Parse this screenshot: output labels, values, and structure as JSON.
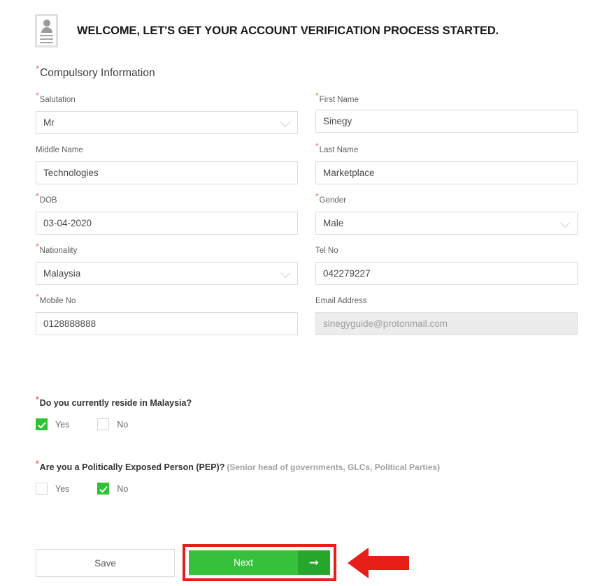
{
  "header": {
    "icon": "id-card-icon",
    "title": "WELCOME, LET'S GET YOUR ACCOUNT VERIFICATION PROCESS STARTED."
  },
  "section": {
    "required_marker": "*",
    "title": "Compulsory Information"
  },
  "colors": {
    "required_asterisk": "#f4665c",
    "accent_green": "#35c23a",
    "accent_green_dark": "#27a62c",
    "annotation_red": "#e81f19",
    "field_border": "#dcdcdc",
    "disabled_bg": "#ececec"
  },
  "fields": [
    {
      "name": "salutation",
      "label": "Salutation",
      "required": true,
      "type": "select",
      "value": "Mr",
      "disabled": false,
      "icon": "chevron-down-icon"
    },
    {
      "name": "first-name",
      "label": "First Name",
      "required": true,
      "type": "text",
      "value": "Sinegy",
      "disabled": false
    },
    {
      "name": "middle-name",
      "label": "Middle Name",
      "required": false,
      "type": "text",
      "value": "Technologies",
      "disabled": false
    },
    {
      "name": "last-name",
      "label": "Last Name",
      "required": true,
      "type": "text",
      "value": "Marketplace",
      "disabled": false
    },
    {
      "name": "dob",
      "label": "DOB",
      "required": true,
      "type": "text",
      "value": "03-04-2020",
      "disabled": false
    },
    {
      "name": "gender",
      "label": "Gender",
      "required": true,
      "type": "select",
      "value": "Male",
      "disabled": false,
      "icon": "chevron-down-icon"
    },
    {
      "name": "nationality",
      "label": "Nationality",
      "required": true,
      "type": "select",
      "value": "Malaysia",
      "disabled": false,
      "icon": "chevron-down-icon"
    },
    {
      "name": "tel-no",
      "label": "Tel No",
      "required": false,
      "type": "text",
      "value": "042279227",
      "disabled": false
    },
    {
      "name": "mobile-no",
      "label": "Mobile No",
      "required": true,
      "type": "text",
      "value": "0128888888",
      "disabled": false
    },
    {
      "name": "email-address",
      "label": "Email Address",
      "required": false,
      "type": "text",
      "value": "sinegyguide@protonmail.com",
      "disabled": true
    }
  ],
  "questions": [
    {
      "name": "reside-in-malaysia",
      "required": true,
      "text": "Do you currently reside in Malaysia?",
      "hint": "",
      "options": [
        {
          "label": "Yes",
          "checked": true
        },
        {
          "label": "No",
          "checked": false
        }
      ]
    },
    {
      "name": "politically-exposed-person",
      "required": true,
      "text": "Are you a Politically Exposed Person (PEP)?",
      "hint": "(Senior head of governments, GLCs, Political Parties)",
      "options": [
        {
          "label": "Yes",
          "checked": false
        },
        {
          "label": "No",
          "checked": true
        }
      ]
    }
  ],
  "footer": {
    "save_label": "Save",
    "next_label": "Next",
    "next_arrow_icon": "arrow-right-icon"
  },
  "annotation": {
    "arrow_icon": "left-pointing-arrow-annotation"
  }
}
